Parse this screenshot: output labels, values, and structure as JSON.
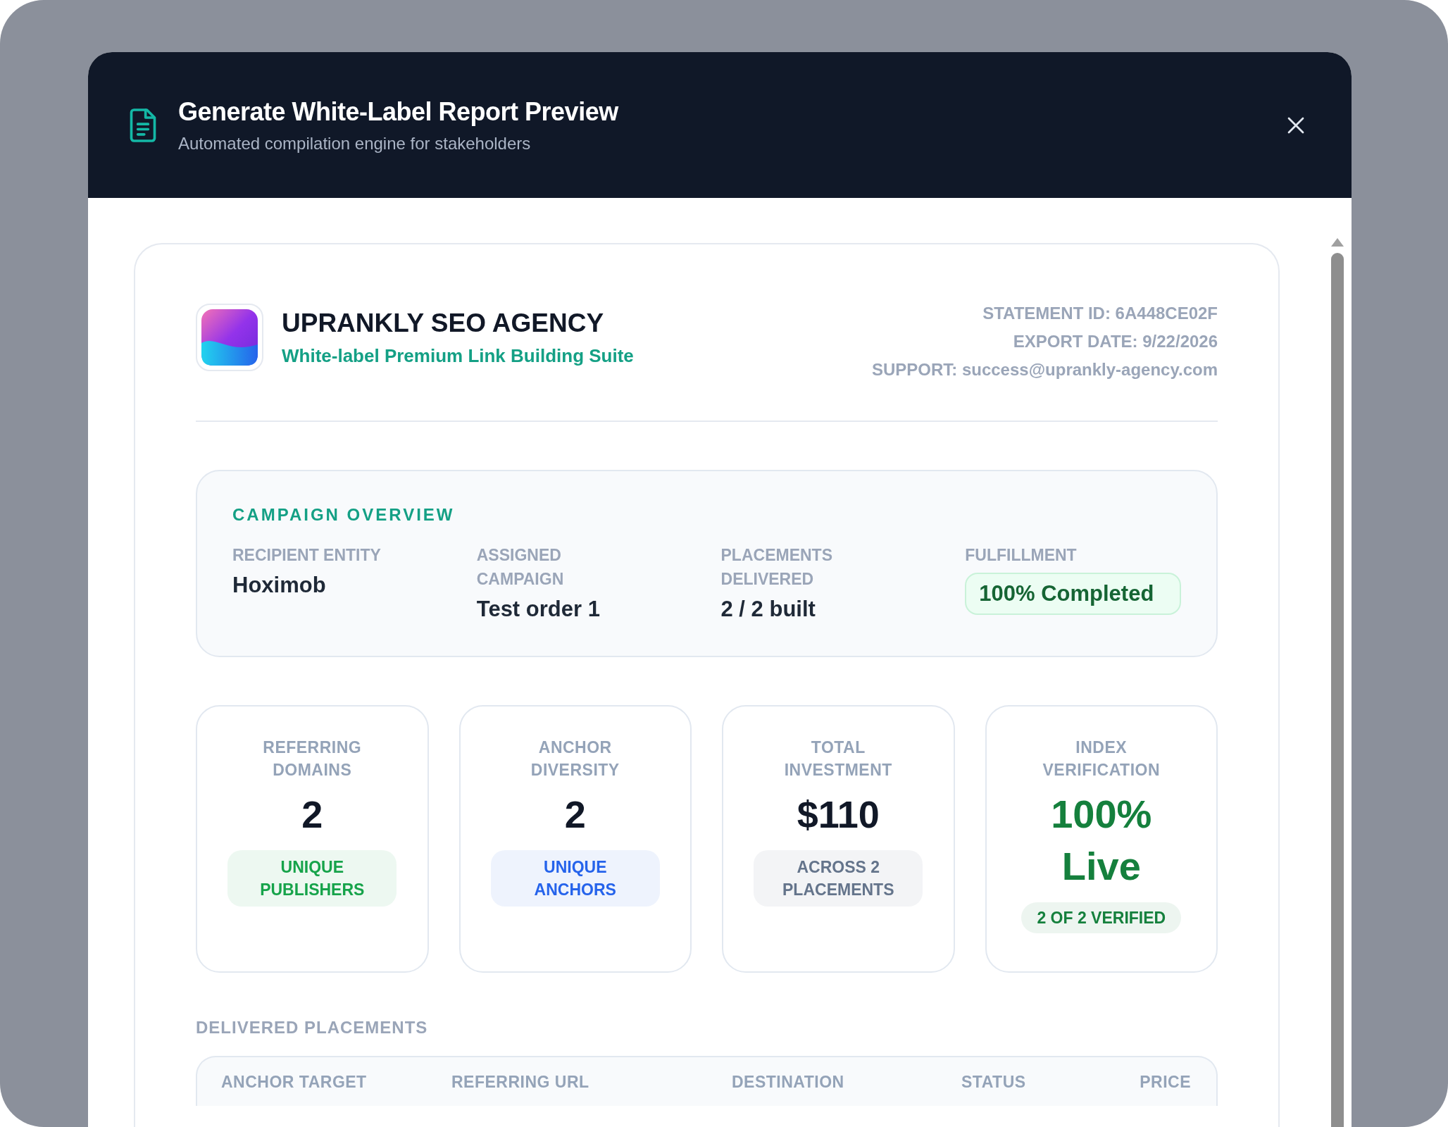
{
  "modal": {
    "title": "Generate White-Label Report Preview",
    "subtitle": "Automated compilation engine for stakeholders"
  },
  "agency": {
    "name": "UPRANKLY SEO AGENCY",
    "tagline": "White-label Premium Link Building Suite"
  },
  "meta": [
    "STATEMENT ID: 6A448CE02F",
    "EXPORT DATE: 9/22/2026",
    "SUPPORT: success@uprankly-agency.com"
  ],
  "overview": {
    "title": "CAMPAIGN OVERVIEW",
    "fields": [
      {
        "kind": "text",
        "label": "RECIPIENT ENTITY",
        "value": "Hoximob"
      },
      {
        "kind": "text",
        "label": "ASSIGNED CAMPAIGN",
        "value": "Test order 1"
      },
      {
        "kind": "text",
        "label": "PLACEMENTS DELIVERED",
        "value": "2 / 2 built"
      },
      {
        "kind": "badge",
        "label": "FULFILLMENT",
        "value": "100% Completed"
      }
    ]
  },
  "stats": [
    {
      "kind": "plain",
      "label": "REFERRING DOMAINS",
      "value": "2",
      "badge": "UNIQUE PUBLISHERS",
      "color": "#16a34a"
    },
    {
      "kind": "plain",
      "label": "ANCHOR DIVERSITY",
      "value": "2",
      "badge": "UNIQUE ANCHORS",
      "color": "#2563eb"
    },
    {
      "kind": "plain",
      "label": "TOTAL INVESTMENT",
      "value": "$110",
      "badge": "ACROSS 2 PLACEMENTS",
      "color": "#64748b"
    },
    {
      "kind": "highlight",
      "label": "INDEX VERIFICATION",
      "value": "100% Live",
      "badge": "2 OF 2 VERIFIED",
      "color": "#15803d"
    }
  ],
  "placements": {
    "title": "DELIVERED PLACEMENTS",
    "columns": [
      "ANCHOR TARGET",
      "REFERRING URL",
      "DESTINATION",
      "STATUS",
      "PRICE"
    ]
  }
}
